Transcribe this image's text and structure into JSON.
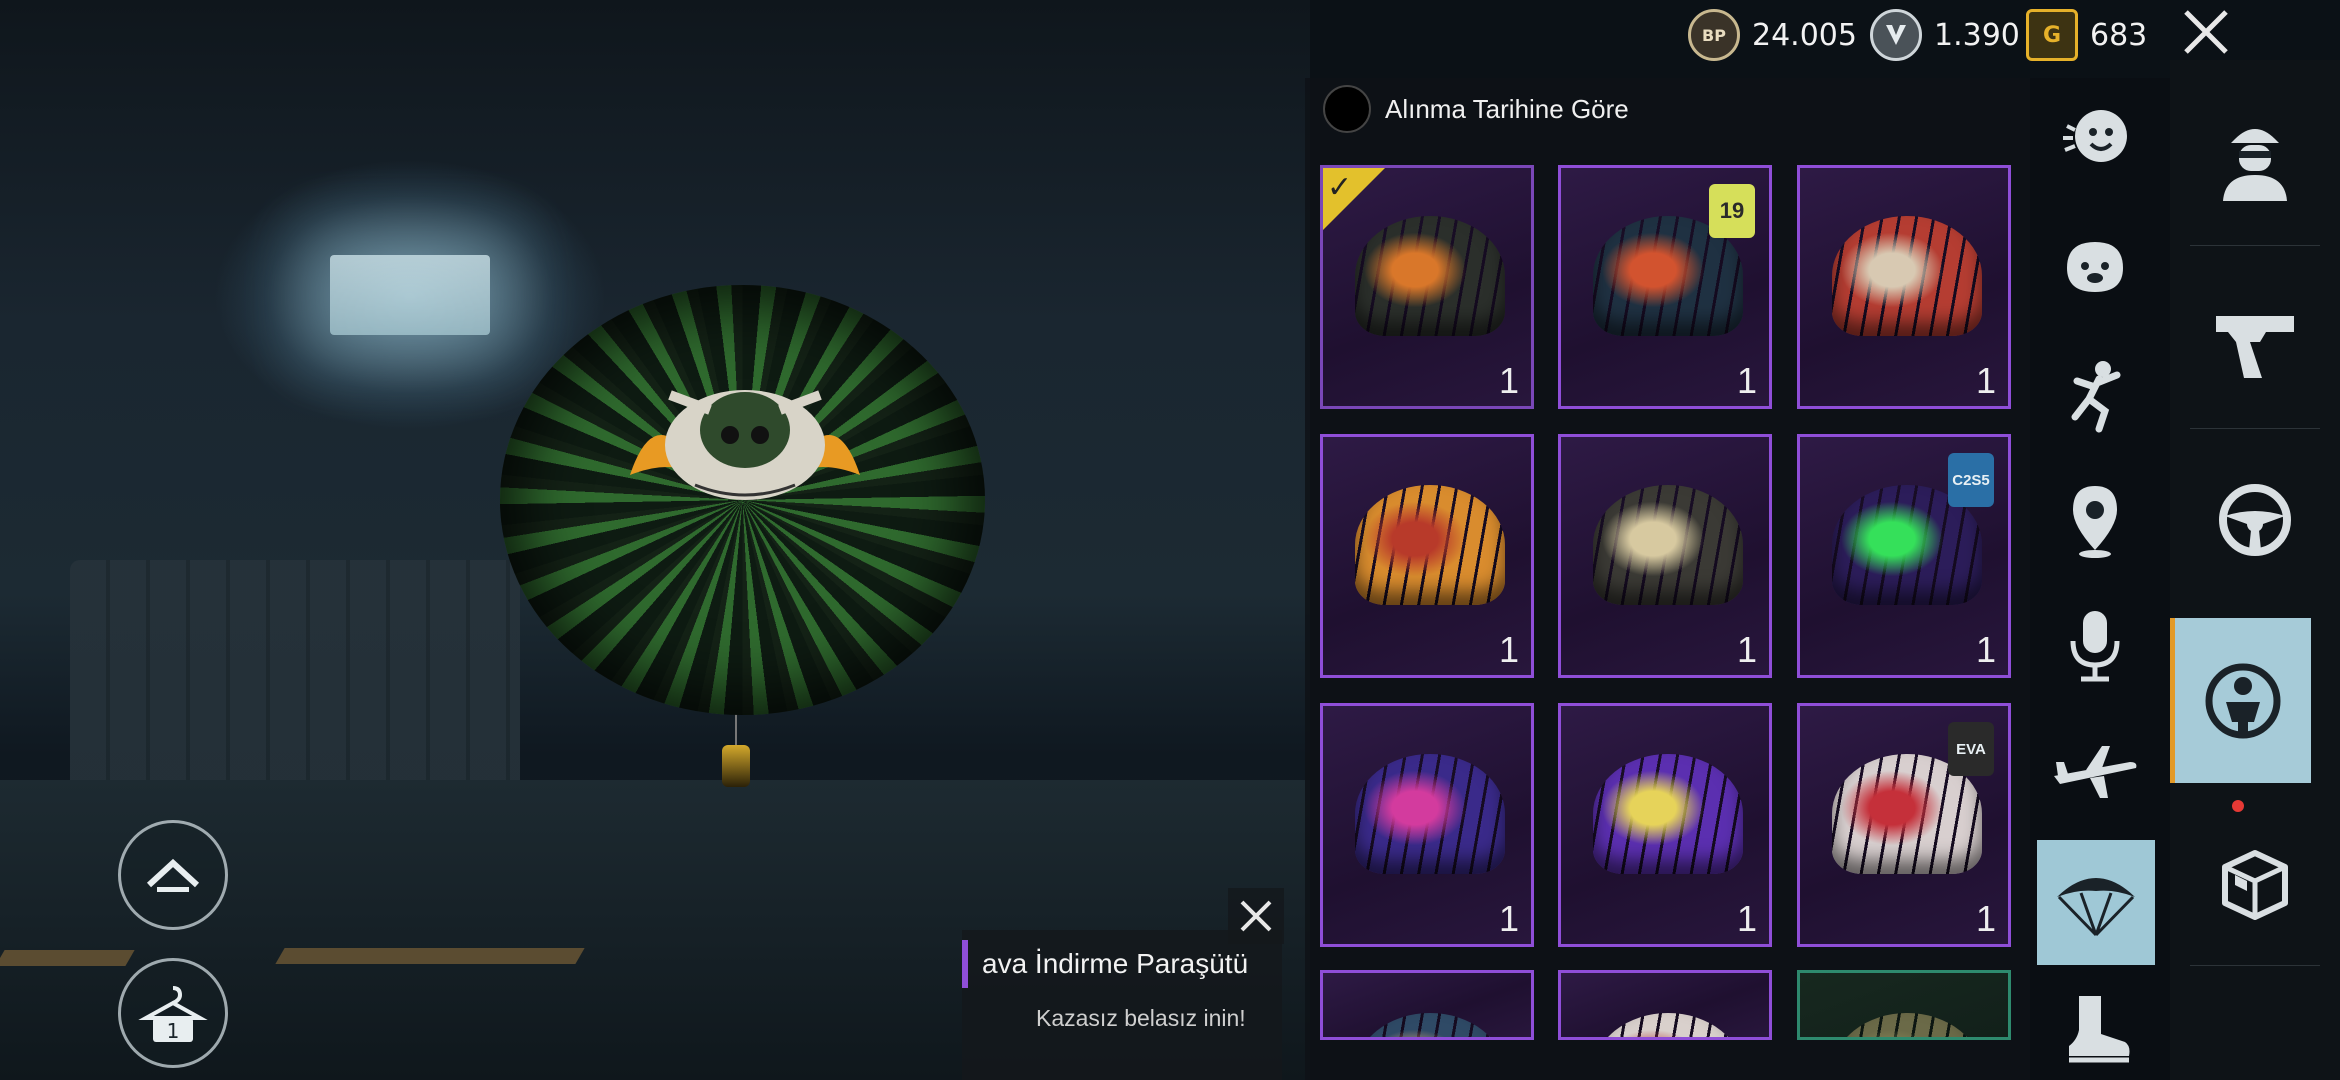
{
  "currencies": {
    "bp": {
      "icon": "bp-coin-icon",
      "label": "BP",
      "value": "24.005",
      "color": "#c8b88f"
    },
    "silver": {
      "icon": "silver-fragment-icon",
      "value": "1.390",
      "color": "#cfd6da"
    },
    "uc": {
      "icon": "g-coin-icon",
      "label": "G",
      "value": "683",
      "color": "#e6b12a"
    }
  },
  "sort": {
    "label": "Alınma Tarihine Göre"
  },
  "items": [
    {
      "count": "1",
      "color": "#2b2f2b",
      "accent": "#d9772a",
      "equipped": true
    },
    {
      "count": "1",
      "color": "#1f3142",
      "accent": "#d2532f",
      "badge": "19",
      "badge_color": "#d6df5a"
    },
    {
      "count": "1",
      "color": "#b53d32",
      "accent": "#d8c9b2"
    },
    {
      "count": "1",
      "color": "#d98c2e",
      "accent": "#b83a2a"
    },
    {
      "count": "1",
      "color": "#3b3a35",
      "accent": "#d7c9a0"
    },
    {
      "count": "1",
      "color": "#2c1d5a",
      "accent": "#35e05a",
      "badge": "C2S5",
      "badge_color": "#2a6fa6"
    },
    {
      "count": "1",
      "color": "#3a2a8a",
      "accent": "#d33b9e"
    },
    {
      "count": "1",
      "color": "#5b2fb0",
      "accent": "#e6d35a"
    },
    {
      "count": "1",
      "color": "#d8cfcf",
      "accent": "#c5303a",
      "badge": "EVA",
      "badge_color": "#2a2a2a"
    },
    {
      "count": "",
      "color": "#2f4a66",
      "accent": "#d5a27a"
    },
    {
      "count": "",
      "color": "#d9d0cc",
      "accent": "#b23a3a"
    },
    {
      "count": "",
      "color": "#6b6a48",
      "accent": "#8a8a5a"
    }
  ],
  "categories": [
    "emote-icon",
    "pet-icon",
    "dance-icon",
    "location-pin-icon",
    "microphone-icon",
    "airplane-icon",
    "parachute-icon",
    "boot-icon"
  ],
  "right_tabs": [
    "character-icon",
    "pistol-icon",
    "steering-wheel-icon",
    "outfit-icon",
    "crate-icon"
  ],
  "tooltip": {
    "title": "ava İndirme Paraşütü",
    "description": "Kazasız belasız inin!"
  },
  "buttons": {
    "up": "chevron-up-icon",
    "wardrobe": "hanger-icon",
    "wardrobe_count": "1"
  }
}
